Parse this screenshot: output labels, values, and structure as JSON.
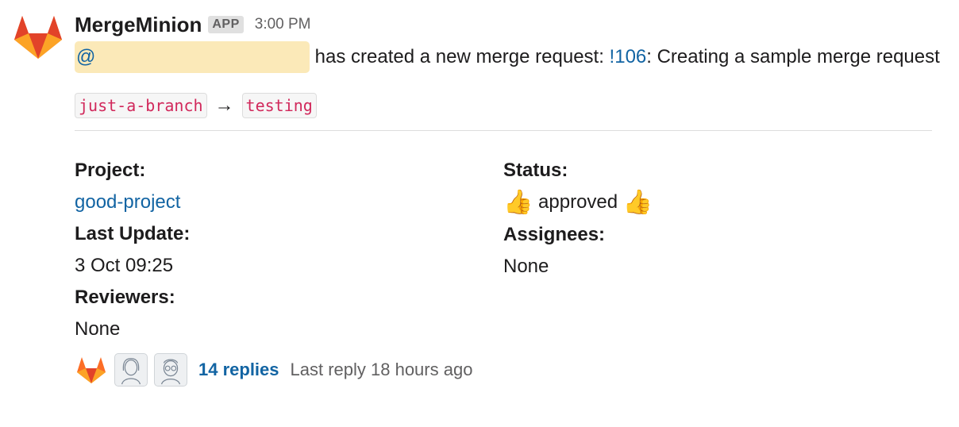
{
  "message": {
    "sender": "MergeMinion",
    "badge": "APP",
    "time": "3:00 PM",
    "mention": "@",
    "text_pre": "has created a new merge request: ",
    "mr_id": "!106",
    "text_post": ": Creating a sample merge request",
    "source_branch": "just-a-branch",
    "arrow": "→",
    "target_branch": "testing"
  },
  "fields": {
    "project_label": "Project:",
    "project_value": "good-project",
    "last_update_label": "Last Update:",
    "last_update_value": "3 Oct 09:25",
    "reviewers_label": "Reviewers:",
    "reviewers_value": "None",
    "status_label": "Status:",
    "status_value": "approved",
    "status_icon": "👍",
    "assignees_label": "Assignees:",
    "assignees_value": "None"
  },
  "thread": {
    "replies": "14 replies",
    "last_reply": "Last reply 18 hours ago"
  },
  "colors": {
    "link": "#1264a3",
    "mention_bg": "#fbe9b8",
    "code": "#d1285b"
  }
}
